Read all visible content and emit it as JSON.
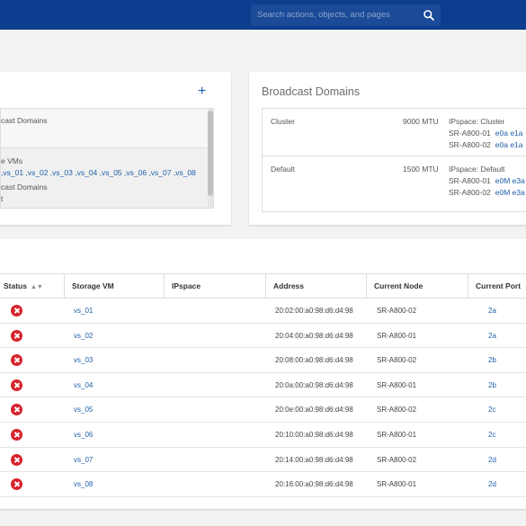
{
  "header": {
    "search_placeholder": "Search actions, objects, and pages"
  },
  "left_card": {
    "row1_line1": "cast Domains",
    "row2_line1": "e VMs",
    "svm_links": ",vs_01 ,vs_02 ,vs_03 ,vs_04 ,vs_05 ,vs_06 ,vs_07 ,vs_08",
    "row2_line3": "cast Domains",
    "row2_line4": "t"
  },
  "broadcast_domains": {
    "title": "Broadcast Domains",
    "rows": [
      {
        "name": "Cluster",
        "mtu": "9000 MTU",
        "ipspace": "IPspace: Cluster",
        "nodes": [
          {
            "node": "SR-A800-01",
            "ports": "e0a  e1a"
          },
          {
            "node": "SR-A800-02",
            "ports": "e0a  e1a"
          }
        ]
      },
      {
        "name": "Default",
        "mtu": "1500 MTU",
        "ipspace": "IPspace: Default",
        "nodes": [
          {
            "node": "SR-A800-01",
            "ports": "e0M  e3a  e"
          },
          {
            "node": "SR-A800-02",
            "ports": "e0M  e3a  e"
          }
        ]
      }
    ]
  },
  "table": {
    "columns": [
      "Status",
      "Storage VM",
      "IPspace",
      "Address",
      "Current Node",
      "Current Port"
    ],
    "rows": [
      {
        "svm": "vs_01",
        "ipspace": "",
        "address": "20:02:00:a0:98:d6:d4:98",
        "node": "SR-A800-02",
        "port": "2a"
      },
      {
        "svm": "vs_02",
        "ipspace": "",
        "address": "20:04:00:a0:98:d6:d4:98",
        "node": "SR-A800-01",
        "port": "2a"
      },
      {
        "svm": "vs_03",
        "ipspace": "",
        "address": "20:08:00:a0:98:d6:d4:98",
        "node": "SR-A800-02",
        "port": "2b"
      },
      {
        "svm": "vs_04",
        "ipspace": "",
        "address": "20:0a:00:a0:98:d6:d4:98",
        "node": "SR-A800-01",
        "port": "2b"
      },
      {
        "svm": "vs_05",
        "ipspace": "",
        "address": "20:0e:00:a0:98:d6:d4:98",
        "node": "SR-A800-02",
        "port": "2c"
      },
      {
        "svm": "vs_06",
        "ipspace": "",
        "address": "20:10:00:a0:98:d6:d4:98",
        "node": "SR-A800-01",
        "port": "2c"
      },
      {
        "svm": "vs_07",
        "ipspace": "",
        "address": "20:14:00:a0:98:d6:d4:98",
        "node": "SR-A800-02",
        "port": "2d"
      },
      {
        "svm": "vs_08",
        "ipspace": "",
        "address": "20:16:00:a0:98:d6:d4:98",
        "node": "SR-A800-01",
        "port": "2d"
      }
    ]
  }
}
